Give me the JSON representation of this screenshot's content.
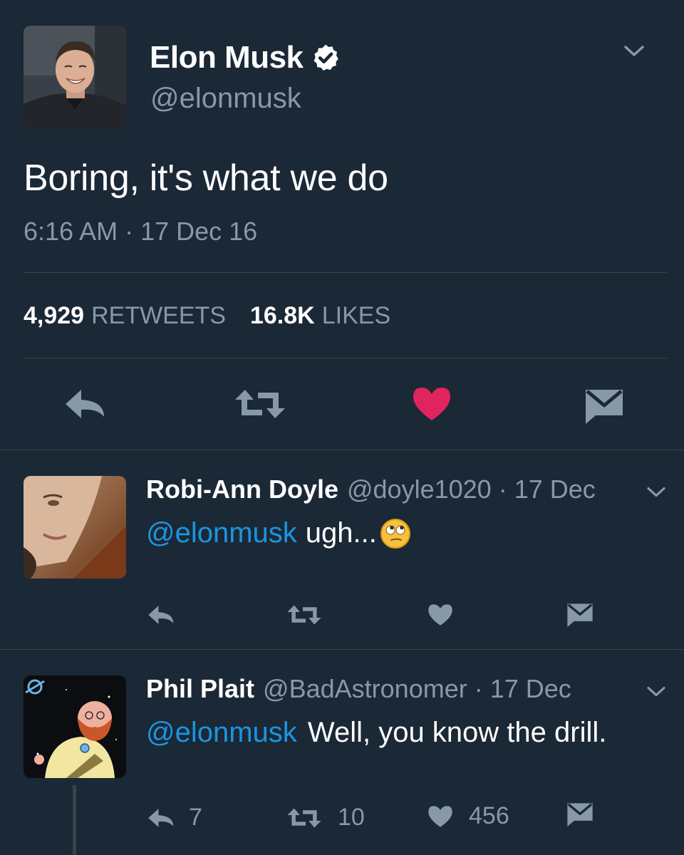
{
  "main_tweet": {
    "author": {
      "name": "Elon Musk",
      "handle": "@elonmusk",
      "verified": true,
      "avatar_icon": "avatar-elon-musk"
    },
    "text": "Boring, it's what we do",
    "timestamp": "6:16 AM · 17 Dec 16",
    "stats": {
      "retweets_count": "4,929",
      "retweets_label": "RETWEETS",
      "likes_count": "16.8K",
      "likes_label": "LIKES"
    },
    "liked": true
  },
  "replies": [
    {
      "name": "Robi-Ann Doyle",
      "handle": "@doyle1020",
      "date_sep": "·",
      "date": "17 Dec",
      "mention": "@elonmusk",
      "text": "ugh...",
      "emoji": "rolling-eyes-emoji",
      "counts": {
        "reply": "",
        "retweet": "",
        "like": ""
      }
    },
    {
      "name": "Phil Plait",
      "handle": "@BadAstronomer",
      "date_sep": "·",
      "date": "17 Dec",
      "mention": "@elonmusk",
      "text": "Well, you know the drill.",
      "counts": {
        "reply": "7",
        "retweet": "10",
        "like": "456"
      }
    }
  ],
  "colors": {
    "background": "#1b2836",
    "divider": "#38444d",
    "muted": "#8899a6",
    "link": "#1b95e0",
    "like_active": "#e0245e"
  }
}
